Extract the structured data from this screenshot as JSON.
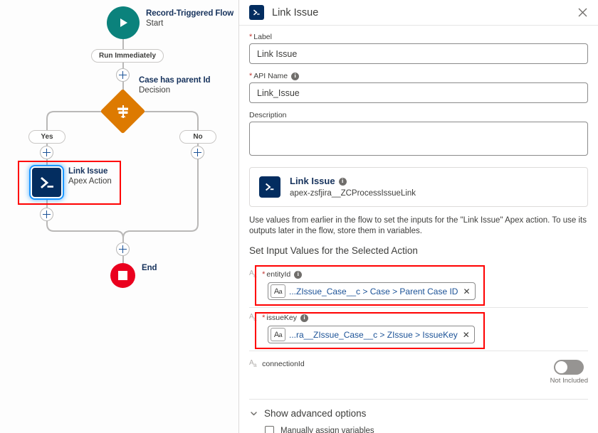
{
  "canvas": {
    "start": {
      "title": "Record-Triggered Flow",
      "subtitle": "Start",
      "icon": "play-icon"
    },
    "run_pill": "Run Immediately",
    "decision": {
      "title": "Case has parent Id",
      "subtitle": "Decision",
      "icon": "decision-diamond-icon"
    },
    "branch_yes": "Yes",
    "branch_no": "No",
    "apex": {
      "title": "Link Issue",
      "subtitle": "Apex Action",
      "icon": "apex-terminal-icon"
    },
    "end": {
      "label": "End",
      "icon": "stop-square-icon"
    },
    "colors": {
      "start": "#0b827c",
      "decision": "#dd7a01",
      "apex": "#032d60",
      "end": "#ea001e",
      "highlight": "#ff0000",
      "connector": "#b9b8b7",
      "plus": "#1b5297"
    }
  },
  "panel": {
    "header": {
      "title": "Link Issue",
      "icon": "apex-terminal-icon",
      "close_icon": "close-icon"
    },
    "label_field": {
      "label": "Label",
      "value": "Link Issue",
      "required": true
    },
    "api_name_field": {
      "label": "API Name",
      "value": "Link_Issue",
      "required": true,
      "info_icon": "info-icon"
    },
    "description_field": {
      "label": "Description",
      "value": "",
      "required": false
    },
    "action_card": {
      "name": "Link Issue",
      "api": "apex-zsfjira__ZCProcessIssueLink",
      "icon": "apex-terminal-icon",
      "info_icon": "info-icon"
    },
    "help_text": "Use values from earlier in the flow to set the inputs for the \"Link Issue\" Apex action. To use its outputs later in the flow, store them in variables.",
    "section_heading": "Set Input Values for the Selected Action",
    "inputs": [
      {
        "name": "entityId",
        "required": true,
        "type_icon": "text-type-icon",
        "info_icon": "info-icon",
        "value": "...ZIssue_Case__c > Case > Parent Case ID",
        "badge": "Aa",
        "clear_icon": "clear-icon",
        "highlighted": true
      },
      {
        "name": "issueKey",
        "required": true,
        "type_icon": "text-type-icon",
        "info_icon": "info-icon",
        "value": "...ra__ZIssue_Case__c > ZIssue > IssueKey",
        "badge": "Aa",
        "clear_icon": "clear-icon",
        "highlighted": true
      }
    ],
    "connection_row": {
      "name": "connectionId",
      "type_icon": "text-type-icon",
      "toggle_state": "off",
      "toggle_caption": "Not Included"
    },
    "advanced": {
      "toggle_label": "Show advanced options",
      "chevron_icon": "chevron-down-icon",
      "checkbox_label": "Manually assign variables",
      "checkbox_checked": false
    }
  }
}
